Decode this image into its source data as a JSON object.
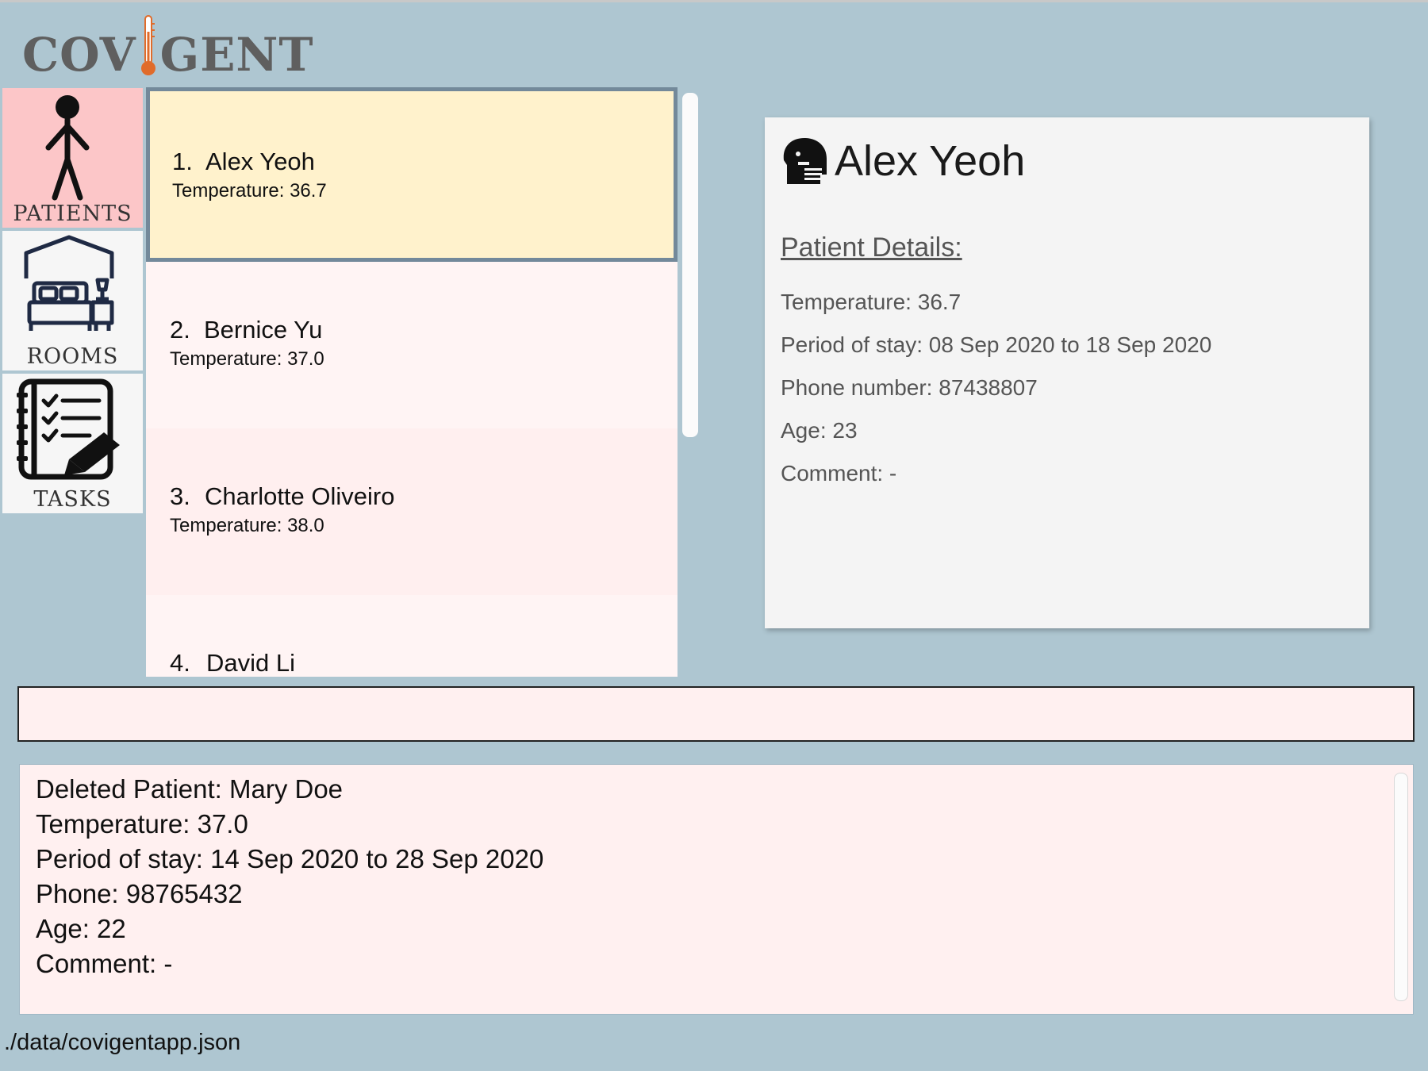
{
  "app": {
    "logo_left": "COV",
    "logo_right": "GENT"
  },
  "nav": [
    {
      "label": "PATIENTS",
      "icon": "person-icon",
      "active": true
    },
    {
      "label": "ROOMS",
      "icon": "bed-room-icon",
      "active": false
    },
    {
      "label": "TASKS",
      "icon": "checklist-icon",
      "active": false
    }
  ],
  "patients": [
    {
      "index": "1.",
      "name": "Alex Yeoh",
      "temperature": "Temperature: 36.7"
    },
    {
      "index": "2.",
      "name": "Bernice Yu",
      "temperature": "Temperature: 37.0"
    },
    {
      "index": "3.",
      "name": "Charlotte Oliveiro",
      "temperature": "Temperature: 38.0"
    },
    {
      "index": "4.",
      "name": "David Li",
      "temperature": ""
    }
  ],
  "details": {
    "name": "Alex Yeoh",
    "heading": "Patient Details:",
    "temperature": "Temperature: 36.7",
    "period": "Period of stay: 08 Sep 2020 to 18 Sep 2020",
    "phone": "Phone number: 87438807",
    "age": "Age: 23",
    "comment": "Comment: -"
  },
  "command": {
    "value": ""
  },
  "result": {
    "lines": [
      "Deleted Patient: Mary Doe",
      "Temperature: 37.0",
      "Period of stay: 14 Sep 2020 to 28 Sep 2020",
      "Phone: 98765432",
      "Age: 22",
      "Comment: -"
    ]
  },
  "status": {
    "path": "./data/covigentapp.json"
  },
  "colors": {
    "background": "#aec6d1",
    "active_nav": "#fcc6c8",
    "selected_card": "#fff2cc",
    "card": "#fff4f4",
    "thermometer": "#e06b2a"
  }
}
